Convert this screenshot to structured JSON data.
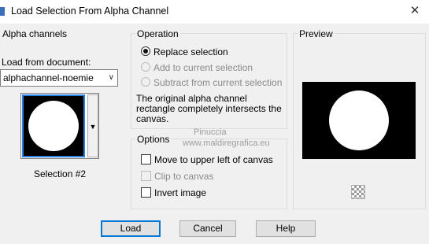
{
  "window": {
    "title": "Load Selection From Alpha Channel",
    "close_glyph": "✕"
  },
  "alpha_channels": {
    "title": "Alpha channels",
    "load_from_label": "Load from document:",
    "document_value": "alphachannel-noemie",
    "selection_label": "Selection #2"
  },
  "operation": {
    "title": "Operation",
    "options": [
      {
        "label": "Replace selection",
        "selected": true,
        "enabled": true
      },
      {
        "label": "Add to current selection",
        "selected": false,
        "enabled": false
      },
      {
        "label": "Subtract from current selection",
        "selected": false,
        "enabled": false
      }
    ],
    "description": "The original alpha channel rectangle completely intersects the canvas."
  },
  "options": {
    "title": "Options",
    "items": [
      {
        "label": "Move to upper left of canvas",
        "checked": false,
        "enabled": true
      },
      {
        "label": "Clip to canvas",
        "checked": false,
        "enabled": false
      },
      {
        "label": "Invert image",
        "checked": false,
        "enabled": true
      }
    ]
  },
  "preview": {
    "title": "Preview"
  },
  "buttons": {
    "load": "Load",
    "cancel": "Cancel",
    "help": "Help"
  },
  "watermark": {
    "name": "Pinuccia",
    "url": "www.maldiregrafica.eu"
  },
  "icons": {
    "close": "close-icon",
    "dropdown": "chevron-down-icon",
    "thumb_dropdown": "triangle-down-icon",
    "transparency": "checkerboard-icon"
  },
  "colors": {
    "selection_border": "#2c7de0",
    "default_button_border": "#0078d7"
  }
}
